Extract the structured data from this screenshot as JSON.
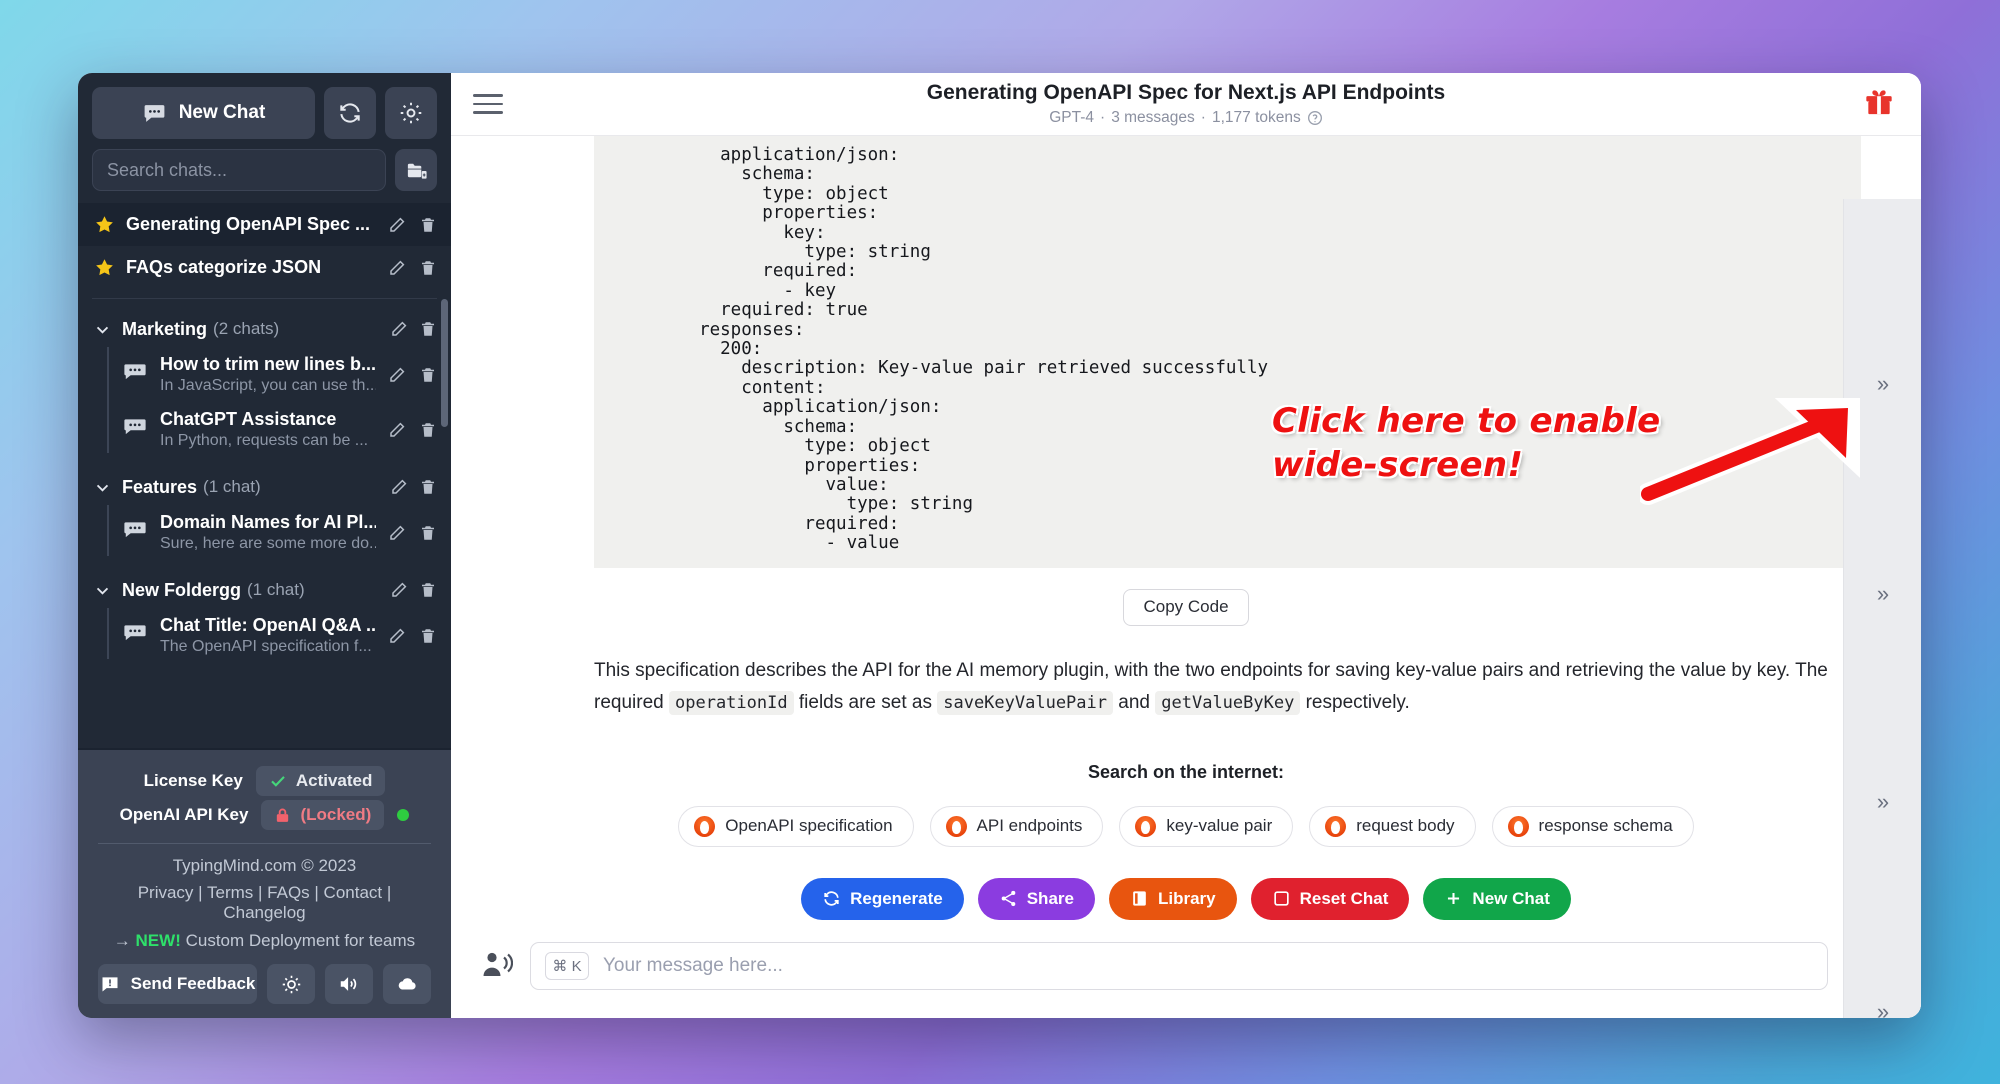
{
  "sidebar": {
    "new_chat_label": "New Chat",
    "refresh_icon": "refresh-icon",
    "settings_icon": "gear-icon",
    "search_placeholder": "Search chats...",
    "new_folder_icon": "new-folder-icon",
    "pinned_chats": [
      {
        "title": "Generating OpenAPI Spec ...",
        "starred": true,
        "active": true
      },
      {
        "title": "FAQs categorize JSON",
        "starred": true,
        "active": false
      }
    ],
    "folders": [
      {
        "name": "Marketing",
        "count": "(2 chats)",
        "chats": [
          {
            "title": "How to trim new lines b...",
            "snippet": "In JavaScript, you can use th..."
          },
          {
            "title": "ChatGPT Assistance",
            "snippet": "In Python, requests can be ..."
          }
        ]
      },
      {
        "name": "Features",
        "count": "(1 chat)",
        "chats": [
          {
            "title": "Domain Names for AI Pl...",
            "snippet": "Sure, here are some more do..."
          }
        ]
      },
      {
        "name": "New Foldergg",
        "count": "(1 chat)",
        "chats": [
          {
            "title": "Chat Title: OpenAI Q&A ...",
            "snippet": "The OpenAPI specification f..."
          }
        ]
      }
    ],
    "footer": {
      "license_label": "License Key",
      "license_status": "Activated",
      "api_label": "OpenAI API Key",
      "api_status": "(Locked)",
      "copyright": "TypingMind.com © 2023",
      "links": [
        "Privacy",
        "Terms",
        "FAQs",
        "Contact",
        "Changelog"
      ],
      "new_prefix": "→",
      "new_tag": "NEW!",
      "new_text": "Custom Deployment for teams",
      "feedback_label": "Send Feedback",
      "theme_icon": "sun-icon",
      "sound_icon": "speaker-icon",
      "cloud_icon": "cloud-icon"
    }
  },
  "header": {
    "menu_icon": "hamburger-icon",
    "title": "Generating OpenAPI Spec for Next.js API Endpoints",
    "model": "GPT-4",
    "messages": "3 messages",
    "tokens": "1,177 tokens",
    "help_icon": "question-circle-icon",
    "gift_icon": "gift-icon"
  },
  "message": {
    "code_lines": [
      "    application/json:",
      "      schema:",
      "        type: object",
      "        properties:",
      "          key:",
      "            type: string",
      "        required:",
      "          - key",
      "    required: true",
      "  responses:",
      "    200:",
      "      description: Key-value pair retrieved successfully",
      "      content:",
      "        application/json:",
      "          schema:",
      "            type: object",
      "            properties:",
      "              value:",
      "                type: string",
      "            required:",
      "              - value"
    ],
    "copy_label": "Copy Code",
    "paragraph_part1": "This specification describes the API for the AI memory plugin, with the two endpoints for saving key-value pairs and retrieving the value by key. The required",
    "paragraph_code1": "operationId",
    "paragraph_part2": "fields are set as",
    "paragraph_code2": "saveKeyValuePair",
    "paragraph_part3": "and",
    "paragraph_code3": "getValueByKey",
    "paragraph_part4": "respectively."
  },
  "search_suggestions": {
    "label": "Search on the internet:",
    "chips": [
      "OpenAPI specification",
      "API endpoints",
      "key-value pair",
      "request body",
      "response schema"
    ]
  },
  "actions": [
    {
      "label": "Regenerate",
      "color": "#2563eb",
      "icon": "regenerate-icon"
    },
    {
      "label": "Share",
      "color": "#8b3ce0",
      "icon": "share-icon"
    },
    {
      "label": "Library",
      "color": "#e8550f",
      "icon": "library-icon"
    },
    {
      "label": "Reset Chat",
      "color": "#e0212e",
      "icon": "reset-icon"
    },
    {
      "label": "New Chat",
      "color": "#11a64a",
      "icon": "plus-icon"
    }
  ],
  "composer": {
    "voice_icon": "voice-person-icon",
    "shortcut": "⌘ K",
    "placeholder": "Your message here...",
    "mic_icon": "microphone-icon"
  },
  "rail": {
    "expand_icon": "chevron-double-right-icon",
    "buttons": [
      "»",
      "»",
      "»",
      "»"
    ]
  },
  "annotation": {
    "line1": "Click here to enable",
    "line2": "wide-screen!",
    "color": "#ee1111",
    "arrow": "arrow-pointing-up-right"
  }
}
